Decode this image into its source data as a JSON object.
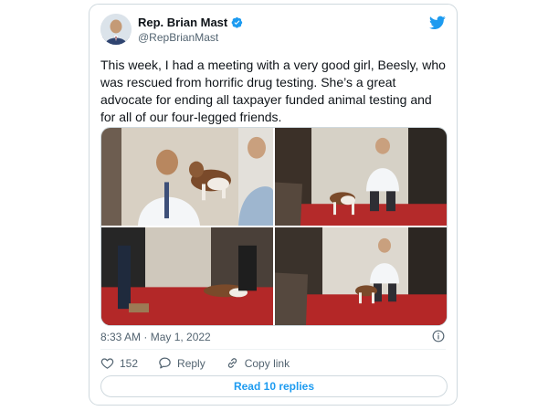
{
  "author": {
    "name": "Rep. Brian Mast",
    "handle": "@RepBrianMast",
    "verified": true
  },
  "tweet": {
    "text": "This week, I had a meeting with a very good girl, Beesly, who was rescued from horrific drug testing. She’s a great advocate for ending all taxpayer funded animal testing and for all of our four-legged friends.",
    "timestamp": "8:33 AM · May 1, 2022"
  },
  "media": {
    "photo_count": 4
  },
  "actions": {
    "like_count": "152",
    "reply_label": "Reply",
    "copy_link_label": "Copy link"
  },
  "read_replies_label": "Read 10 replies",
  "colors": {
    "accent": "#1d9bf0",
    "text": "#0f1419",
    "secondary": "#536471",
    "border": "#cfd9de"
  },
  "icons": [
    "twitter-bird-icon",
    "verified-badge-icon",
    "info-icon",
    "heart-icon",
    "reply-bubble-icon",
    "link-icon"
  ]
}
